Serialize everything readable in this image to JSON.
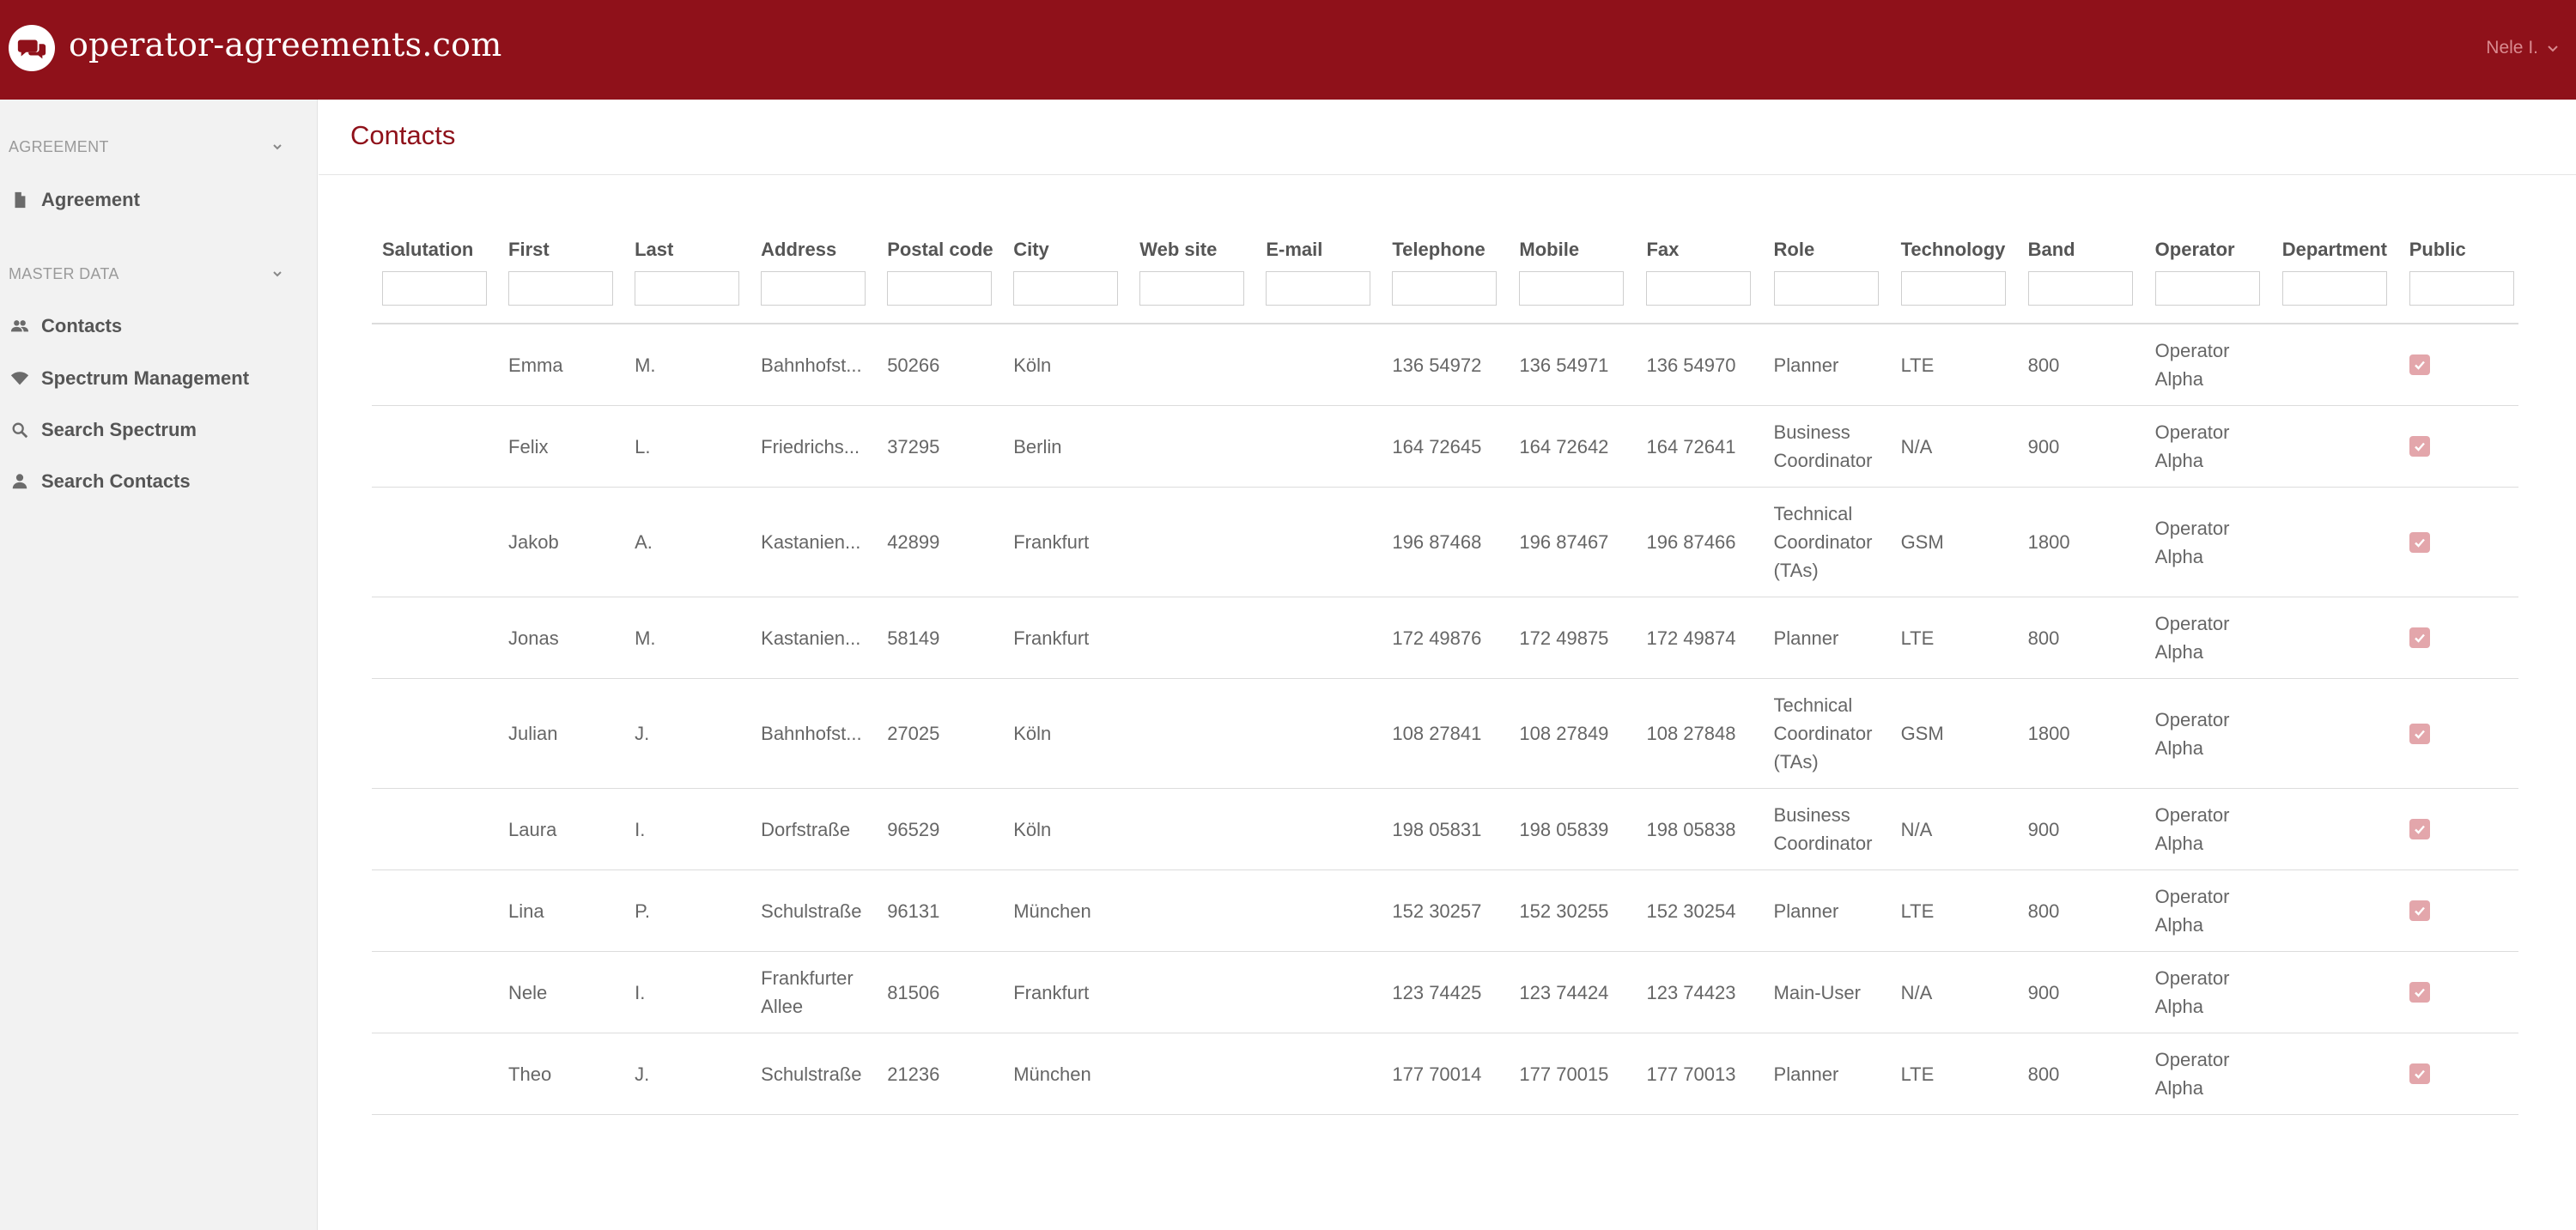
{
  "header": {
    "brand": "operator-agreements.com",
    "user": "Nele I."
  },
  "sidebar": {
    "sections": [
      {
        "label": "AGREEMENT",
        "items": [
          {
            "label": "Agreement",
            "icon": "document-icon"
          }
        ]
      },
      {
        "label": "MASTER DATA",
        "items": [
          {
            "label": "Contacts",
            "icon": "people-icon"
          },
          {
            "label": "Spectrum Management",
            "icon": "wifi-icon"
          },
          {
            "label": "Search Spectrum",
            "icon": "search-icon"
          },
          {
            "label": "Search Contacts",
            "icon": "person-icon"
          }
        ]
      }
    ]
  },
  "page": {
    "title": "Contacts"
  },
  "table": {
    "columns": [
      "Salutation",
      "First",
      "Last",
      "Address",
      "Postal code",
      "City",
      "Web site",
      "E-mail",
      "Telephone",
      "Mobile",
      "Fax",
      "Role",
      "Technology",
      "Band",
      "Operator",
      "Department",
      "Public"
    ],
    "rows": [
      {
        "salutation": "",
        "first": "Emma",
        "last": "M.",
        "address": "Bahnhofst...",
        "postal": "50266",
        "city": "Köln",
        "web": "",
        "email": "",
        "telephone": "136 54972",
        "mobile": "136 54971",
        "fax": "136 54970",
        "role": "Planner",
        "technology": "LTE",
        "band": "800",
        "operator": "Operator Alpha",
        "department": "",
        "public": true
      },
      {
        "salutation": "",
        "first": "Felix",
        "last": "L.",
        "address": "Friedrichs...",
        "postal": "37295",
        "city": "Berlin",
        "web": "",
        "email": "",
        "telephone": "164 72645",
        "mobile": "164 72642",
        "fax": "164 72641",
        "role": "Business Coordinator",
        "technology": "N/A",
        "band": "900",
        "operator": "Operator Alpha",
        "department": "",
        "public": true
      },
      {
        "salutation": "",
        "first": "Jakob",
        "last": "A.",
        "address": "Kastanien...",
        "postal": "42899",
        "city": "Frankfurt",
        "web": "",
        "email": "",
        "telephone": "196 87468",
        "mobile": "196 87467",
        "fax": "196 87466",
        "role": "Technical Coordinator (TAs)",
        "technology": "GSM",
        "band": "1800",
        "operator": "Operator Alpha",
        "department": "",
        "public": true
      },
      {
        "salutation": "",
        "first": "Jonas",
        "last": "M.",
        "address": "Kastanien...",
        "postal": "58149",
        "city": "Frankfurt",
        "web": "",
        "email": "",
        "telephone": "172 49876",
        "mobile": "172 49875",
        "fax": "172 49874",
        "role": "Planner",
        "technology": "LTE",
        "band": "800",
        "operator": "Operator Alpha",
        "department": "",
        "public": true
      },
      {
        "salutation": "",
        "first": "Julian",
        "last": "J.",
        "address": "Bahnhofst...",
        "postal": "27025",
        "city": "Köln",
        "web": "",
        "email": "",
        "telephone": "108 27841",
        "mobile": "108 27849",
        "fax": "108 27848",
        "role": "Technical Coordinator (TAs)",
        "technology": "GSM",
        "band": "1800",
        "operator": "Operator Alpha",
        "department": "",
        "public": true
      },
      {
        "salutation": "",
        "first": "Laura",
        "last": "I.",
        "address": "Dorfstraße",
        "postal": "96529",
        "city": "Köln",
        "web": "",
        "email": "",
        "telephone": "198 05831",
        "mobile": "198 05839",
        "fax": "198 05838",
        "role": "Business Coordinator",
        "technology": "N/A",
        "band": "900",
        "operator": "Operator Alpha",
        "department": "",
        "public": true
      },
      {
        "salutation": "",
        "first": "Lina",
        "last": "P.",
        "address": "Schulstraße",
        "postal": "96131",
        "city": "München",
        "web": "",
        "email": "",
        "telephone": "152 30257",
        "mobile": "152 30255",
        "fax": "152 30254",
        "role": "Planner",
        "technology": "LTE",
        "band": "800",
        "operator": "Operator Alpha",
        "department": "",
        "public": true
      },
      {
        "salutation": "",
        "first": "Nele",
        "last": "I.",
        "address": "Frankfurter Allee",
        "postal": "81506",
        "city": "Frankfurt",
        "web": "",
        "email": "",
        "telephone": "123 74425",
        "mobile": "123 74424",
        "fax": "123 74423",
        "role": "Main-User",
        "technology": "N/A",
        "band": "900",
        "operator": "Operator Alpha",
        "department": "",
        "public": true
      },
      {
        "salutation": "",
        "first": "Theo",
        "last": "J.",
        "address": "Schulstraße",
        "postal": "21236",
        "city": "München",
        "web": "",
        "email": "",
        "telephone": "177 70014",
        "mobile": "177 70015",
        "fax": "177 70013",
        "role": "Planner",
        "technology": "LTE",
        "band": "800",
        "operator": "Operator Alpha",
        "department": "",
        "public": true
      }
    ]
  },
  "colors": {
    "brand": "#8f111a",
    "sidebar_bg": "#f2f2f2",
    "checkbox": "#e3a6ab"
  }
}
